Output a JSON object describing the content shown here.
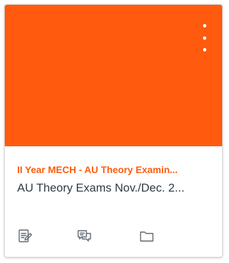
{
  "card": {
    "hero_color": "#ff5a0d",
    "title": "II Year MECH - AU Theory Examin...",
    "title_color": "#ff5a0d",
    "subtitle": "AU Theory Exams Nov./Dec. 2...",
    "menu_icon": "kebab-vertical-icon",
    "actions": [
      {
        "icon": "assignments-icon"
      },
      {
        "icon": "discussions-icon"
      },
      {
        "icon": "files-folder-icon"
      }
    ]
  }
}
